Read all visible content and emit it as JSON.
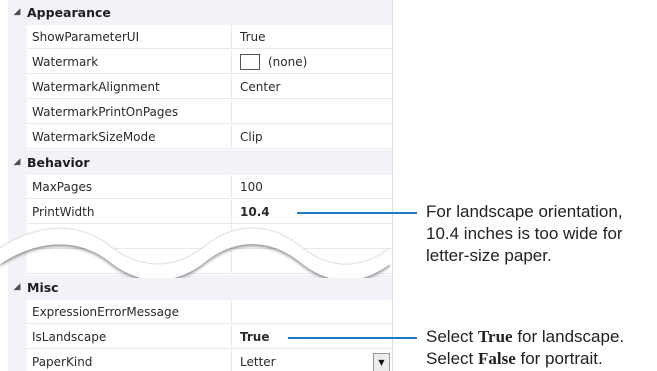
{
  "property_grid": {
    "categories": [
      {
        "label": "Appearance",
        "properties": [
          {
            "name": "ShowParameterUI",
            "value": "True"
          },
          {
            "name": "Watermark",
            "value": "(none)",
            "swatch": true
          },
          {
            "name": "WatermarkAlignment",
            "value": "Center"
          },
          {
            "name": "WatermarkPrintOnPages",
            "value": ""
          },
          {
            "name": "WatermarkSizeMode",
            "value": "Clip"
          }
        ]
      },
      {
        "label": "Behavior",
        "properties": [
          {
            "name": "MaxPages",
            "value": "100"
          },
          {
            "name": "PrintWidth",
            "value": "10.4",
            "bold": true
          }
        ]
      },
      {
        "label": "Misc",
        "properties": [
          {
            "name": "ExpressionErrorMessage",
            "value": ""
          },
          {
            "name": "IsLandscape",
            "value": "True",
            "bold": true
          },
          {
            "name": "PaperKind",
            "value": "Letter",
            "dropdown": true
          }
        ]
      }
    ]
  },
  "callouts": {
    "print_width": [
      "For landscape orientation,",
      "10.4 inches is too wide for",
      "letter-size paper."
    ],
    "is_landscape": {
      "line1_prefix": "Select ",
      "line1_bold": "True",
      "line1_suffix": " for landscape.",
      "line2_prefix": "Select ",
      "line2_bold": "False",
      "line2_suffix": " for portrait."
    }
  },
  "colors": {
    "callout_line": "#1f7ac0",
    "category_band": "#f1f3f8"
  }
}
